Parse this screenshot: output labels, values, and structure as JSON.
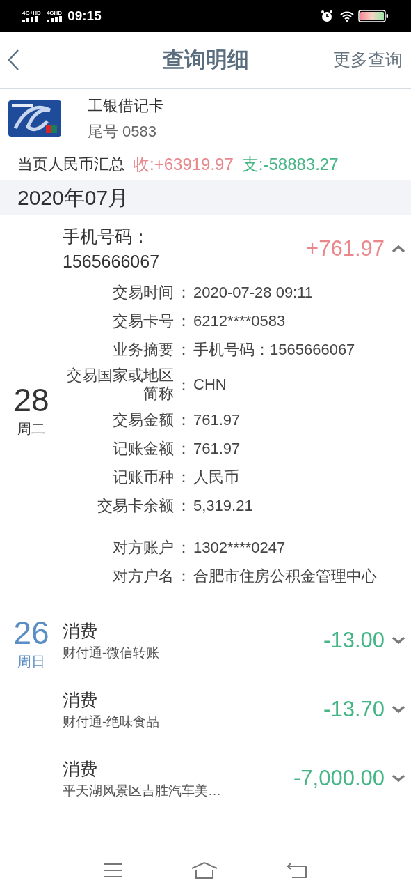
{
  "status_bar": {
    "signals": [
      "4G+HD",
      "4GHD"
    ],
    "time": "09:15"
  },
  "nav": {
    "title": "查询明细",
    "action": "更多查询"
  },
  "card": {
    "name": "工银借记卡",
    "tail": "尾号 0583"
  },
  "summary": {
    "label": "当页人民币汇总",
    "income": "收:+63919.97",
    "expense": "支:-58883.27"
  },
  "month": "2020年07月",
  "days": [
    {
      "day": "28",
      "weekday": "周二",
      "highlighted": false,
      "transactions": [
        {
          "title": "手机号码：1565666067",
          "kind": "income",
          "amount": "+761.97",
          "expanded": true,
          "separator": "：",
          "details": [
            {
              "label": "交易时间",
              "value": "2020-07-28 09:11"
            },
            {
              "label": "交易卡号",
              "value": "6212****0583"
            },
            {
              "label": "业务摘要",
              "value": "手机号码：1565666067"
            },
            {
              "label": "交易国家或地区简称",
              "value": "CHN"
            },
            {
              "label": "交易金额",
              "value": "761.97"
            },
            {
              "label": "记账金额",
              "value": "761.97"
            },
            {
              "label": "记账币种",
              "value": "人民币"
            },
            {
              "label": "交易卡余额",
              "value": "5,319.21"
            }
          ],
          "counterparty": [
            {
              "label": "对方账户",
              "value": "1302****0247"
            },
            {
              "label": "对方户名",
              "value": "合肥市住房公积金管理中心"
            }
          ]
        }
      ]
    },
    {
      "day": "26",
      "weekday": "周日",
      "highlighted": true,
      "transactions": [
        {
          "title": "消费",
          "subtitle": "财付通-微信转账",
          "kind": "expense",
          "amount": "-13.00",
          "expanded": false
        },
        {
          "title": "消费",
          "subtitle": "财付通-绝味食品",
          "kind": "expense",
          "amount": "-13.70",
          "expanded": false
        },
        {
          "title": "消费",
          "subtitle": "平天湖风景区吉胜汽车美…",
          "kind": "expense",
          "amount": "-7,000.00",
          "expanded": false
        }
      ]
    }
  ]
}
